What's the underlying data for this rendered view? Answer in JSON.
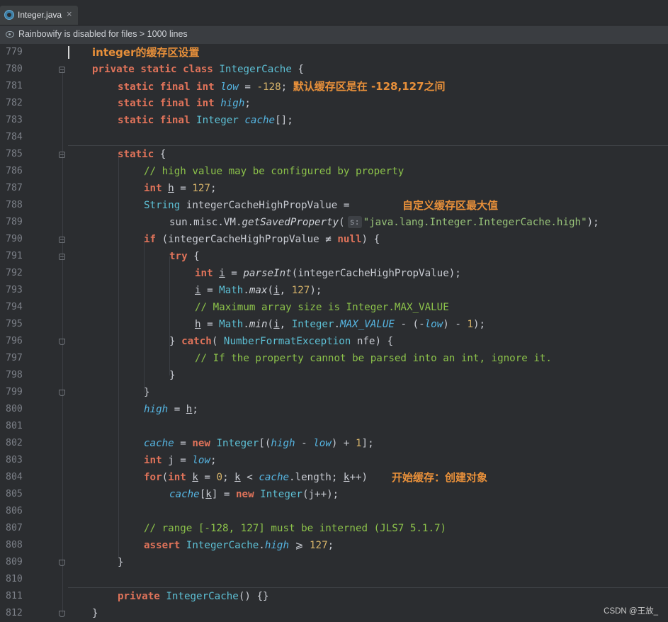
{
  "tab": {
    "label": "Integer.java",
    "close_glyph": "×"
  },
  "banner": {
    "text": "Rainbowify is disabled for files > 1000 lines"
  },
  "annotations": {
    "a779": "integer的缓存区设置",
    "a781": "默认缓存区是在 -128,127之间",
    "a788": "自定义缓存区最大值",
    "a804": "开始缓存：创建对象"
  },
  "param_hint": "s:",
  "lines": [
    {
      "n": "779"
    },
    {
      "n": "780"
    },
    {
      "n": "781"
    },
    {
      "n": "782"
    },
    {
      "n": "783"
    },
    {
      "n": "784"
    },
    {
      "n": "785"
    },
    {
      "n": "786"
    },
    {
      "n": "787"
    },
    {
      "n": "788"
    },
    {
      "n": "789"
    },
    {
      "n": "790"
    },
    {
      "n": "791"
    },
    {
      "n": "792"
    },
    {
      "n": "793"
    },
    {
      "n": "794"
    },
    {
      "n": "795"
    },
    {
      "n": "796"
    },
    {
      "n": "797"
    },
    {
      "n": "798"
    },
    {
      "n": "799"
    },
    {
      "n": "800"
    },
    {
      "n": "801"
    },
    {
      "n": "802"
    },
    {
      "n": "803"
    },
    {
      "n": "804"
    },
    {
      "n": "805"
    },
    {
      "n": "806"
    },
    {
      "n": "807"
    },
    {
      "n": "808"
    },
    {
      "n": "809"
    },
    {
      "n": "810"
    },
    {
      "n": "811"
    },
    {
      "n": "812"
    }
  ],
  "code": {
    "c780": [
      "private static class ",
      "IntegerCache",
      " {"
    ],
    "c781": [
      "static final int ",
      "low",
      " = ",
      "-128",
      ";"
    ],
    "c782": [
      "static final int ",
      "high",
      ";"
    ],
    "c783": [
      "static final ",
      "Integer",
      " ",
      "cache",
      "[];"
    ],
    "c785": [
      "static",
      " {"
    ],
    "c786": "// high value may be configured by property",
    "c787": [
      "int ",
      "h",
      " = ",
      "127",
      ";"
    ],
    "c788": [
      "String",
      " integerCacheHighPropValue ="
    ],
    "c789": [
      "sun.misc.VM.",
      "getSavedProperty",
      "(",
      "\"java.lang.Integer.IntegerCache.high\"",
      ");"
    ],
    "c790": [
      "if",
      " (integerCacheHighPropValue ≠ ",
      "null",
      ") {"
    ],
    "c791": [
      "try",
      " {"
    ],
    "c792": [
      "int ",
      "i",
      " = ",
      "parseInt",
      "(integerCacheHighPropValue);"
    ],
    "c793": [
      "i",
      " = ",
      "Math",
      ".",
      "max",
      "(",
      "i",
      ", ",
      "127",
      ");"
    ],
    "c794": "// Maximum array size is Integer.MAX_VALUE",
    "c795": [
      "h",
      " = ",
      "Math",
      ".",
      "min",
      "(",
      "i",
      ", ",
      "Integer",
      ".",
      "MAX_VALUE",
      " - (-",
      "low",
      ") - ",
      "1",
      ");"
    ],
    "c796": [
      "} ",
      "catch",
      "( ",
      "NumberFormatException",
      " nfe) {"
    ],
    "c797": "// If the property cannot be parsed into an int, ignore it.",
    "c798": "}",
    "c799": "}",
    "c800": [
      "high",
      " = ",
      "h",
      ";"
    ],
    "c802": [
      "cache",
      " = ",
      "new ",
      "Integer",
      "[(",
      "high",
      " - ",
      "low",
      ") + ",
      "1",
      "];"
    ],
    "c803": [
      "int ",
      "j",
      " = ",
      "low",
      ";"
    ],
    "c804": [
      "for",
      "(",
      "int ",
      "k",
      " = ",
      "0",
      "; ",
      "k",
      " < ",
      "cache",
      ".length; ",
      "k",
      "++)"
    ],
    "c805": [
      "cache",
      "[",
      "k",
      "] = ",
      "new ",
      "Integer",
      "(j++);"
    ],
    "c807": "// range [-128, 127] must be interned (JLS7 5.1.7)",
    "c808": [
      "assert ",
      "IntegerCache",
      ".",
      "high",
      " ⩾ ",
      "127",
      ";"
    ],
    "c809": "}",
    "c811": [
      "private ",
      "IntegerCache",
      "() {}"
    ],
    "c812": "}"
  },
  "watermark": "CSDN @王放_",
  "colors": {
    "background": "#2b2d30",
    "keyword": "#e0735a",
    "field": "#56b6e3",
    "number": "#d7b46a",
    "string": "#98c379",
    "comment": "#8cc24a",
    "annotation": "#e8903a"
  }
}
